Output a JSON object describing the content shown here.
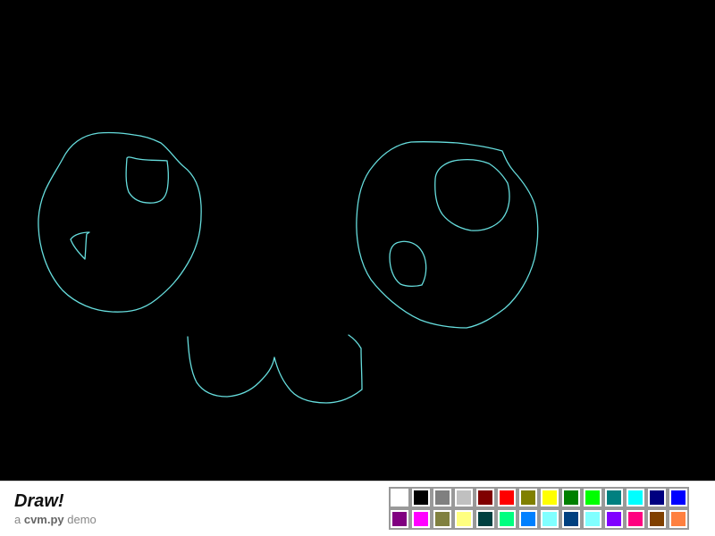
{
  "app": {
    "title": "Draw!",
    "subtitle_prefix": "a ",
    "subtitle_brand": "cvm.py",
    "subtitle_suffix": " demo"
  },
  "canvas": {
    "background": "#000000",
    "stroke_color": "#66dddd"
  },
  "palette": {
    "colors": [
      "#ffffff",
      "#000000",
      "#808080",
      "#c0c0c0",
      "#800000",
      "#ff0000",
      "#808000",
      "#ffff00",
      "#008000",
      "#00ff00",
      "#008080",
      "#00ffff",
      "#000080",
      "#0000ff",
      "#800080",
      "#ff00ff",
      "#808040",
      "#ffff80",
      "#004040",
      "#00ff80",
      "#0080ff",
      "#80ffff",
      "#004080",
      "#80ffff",
      "#8000ff",
      "#ff0080",
      "#804000",
      "#ff8040"
    ]
  }
}
